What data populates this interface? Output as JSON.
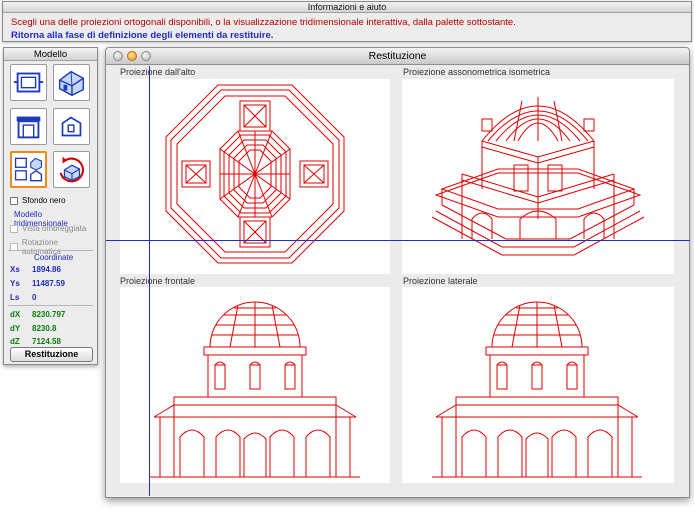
{
  "info": {
    "title": "Informazioni e aiuto",
    "line1": "Scegli una delle proiezioni ortogonali disponibili, o la visualizzazione tridimensionale interattiva, dalla palette sottostante.",
    "line2": "Ritorna alla fase di definizione degli elementi da restituire."
  },
  "palette": {
    "title": "Modello",
    "tools": [
      {
        "icon": "plan-view-icon"
      },
      {
        "icon": "isometric-house-icon"
      },
      {
        "icon": "front-view-icon"
      },
      {
        "icon": "side-view-icon"
      },
      {
        "icon": "four-views-icon",
        "selected": true
      },
      {
        "icon": "rotate-3d-icon"
      }
    ],
    "options": {
      "sfondo_nero": "Sfondo nero",
      "modello_3d": "Modello tridimensionale",
      "vista_ombreggiata": "Vista ombreggiata",
      "rotazione_automatica": "Rotazione automatica"
    },
    "coordinate_label": "Coordinate",
    "coords": [
      {
        "k": "Xs",
        "v": "1894.86"
      },
      {
        "k": "Ys",
        "v": "11487.59"
      },
      {
        "k": "Ls",
        "v": "0"
      }
    ],
    "deltas": [
      {
        "k": "dX",
        "v": "8230.797"
      },
      {
        "k": "dY",
        "v": "8230.8"
      },
      {
        "k": "dZ",
        "v": "7124.58"
      }
    ],
    "button": "Restituzione"
  },
  "window": {
    "title": "Restituzione",
    "views": {
      "top": "Proiezione dall'alto",
      "iso": "Proiezione assonometrica isometrica",
      "front": "Proiezione frontale",
      "side": "Proiezione laterale"
    }
  },
  "colors": {
    "drawing": "#e00000",
    "crosshair": "#1f2cc7",
    "accent_selected": "#ec8a1c"
  }
}
